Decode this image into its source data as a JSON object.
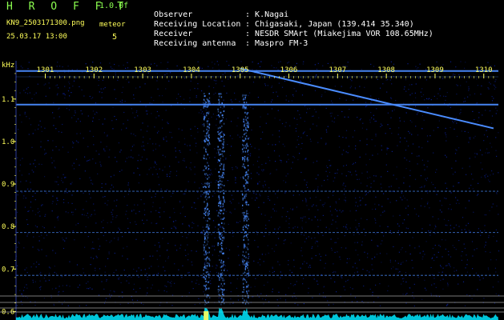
{
  "header": {
    "title": "H R O F F T",
    "version": "1.0.0f",
    "file_name": "KN9_2503171300.png",
    "meteor_label": "meteor",
    "date_time": "25.03.17 13:00",
    "meteor_count": "5"
  },
  "info": [
    {
      "label": "Observer",
      "value": "K.Nagai"
    },
    {
      "label": "Receiving Location",
      "value": "Chigasaki, Japan (139.414 35.340)"
    },
    {
      "label": "Receiver",
      "value": "NESDR SMArt (Miakejima VOR 108.65MHz)"
    },
    {
      "label": "Receiving antenna",
      "value": "Maspro FM-3"
    }
  ],
  "colors": {
    "header_green": "#8cff50",
    "header_yellow": "#ffff5a",
    "tick_text": "#ffff5a",
    "signal": "#4a8cff",
    "noise": "#0a1e8c",
    "spectrum": "#00e8ff",
    "grid_line": "#c8c8c8"
  },
  "chart_data": {
    "type": "heatmap",
    "xunit": "",
    "yunit": "kHz",
    "x_ticks": [
      "1301",
      "1302",
      "1303",
      "1304",
      "1305",
      "1306",
      "1307",
      "1308",
      "1309",
      "1310"
    ],
    "y_ticks": [
      "1.1",
      "1.0",
      "0.9",
      "0.8",
      "0.7",
      "0.6"
    ],
    "xlim": [
      1300.4,
      1310.3
    ],
    "ylim": [
      0.58,
      1.19
    ],
    "carrier_lines_khz": [
      1.166,
      1.087,
      0.883,
      0.786,
      0.685
    ],
    "sweep_line": {
      "start": [
        1305.0,
        1.172
      ],
      "end": [
        1310.2,
        1.031
      ]
    },
    "meteor_echoes_x": [
      1304.3,
      1304.6,
      1305.1
    ]
  }
}
